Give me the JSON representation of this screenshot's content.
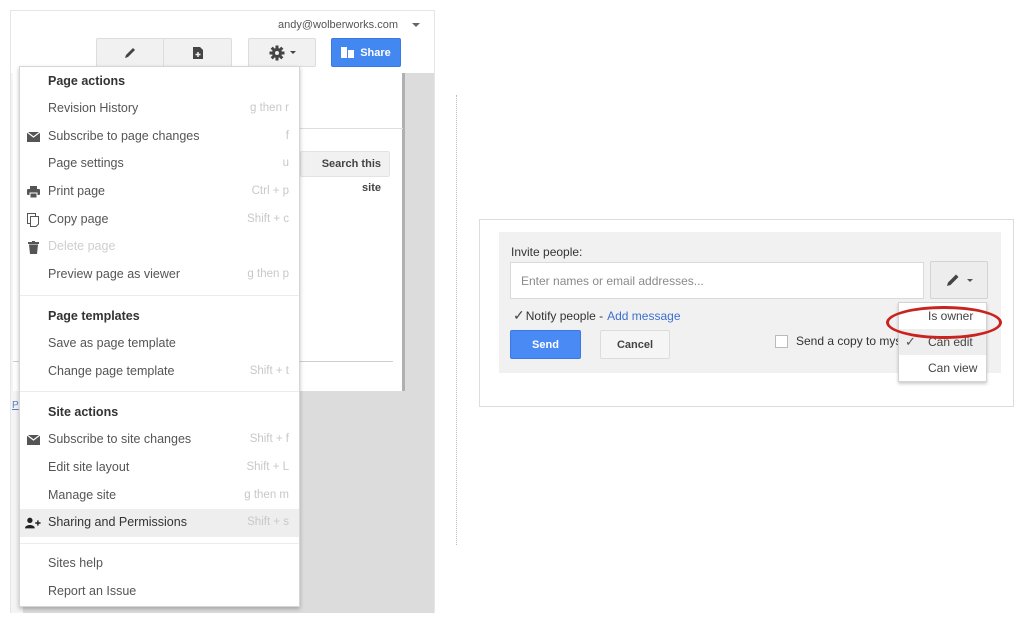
{
  "left_screenshot": {
    "account": {
      "email": "andy@wolberworks.com"
    },
    "toolbar": {
      "edit_icon": "pencil-icon",
      "new_page_icon": "new-page-icon",
      "more_actions_icon": "gear-icon",
      "share_label": "Share",
      "share_icon": "people-icon"
    },
    "search_button_label": "Search this site",
    "side_link_text": "P",
    "menu": {
      "sections": [
        {
          "heading": "Page actions",
          "items": [
            {
              "label": "Revision History",
              "shortcut": "g then r",
              "icon": null,
              "disabled": false
            },
            {
              "label": "Subscribe to page changes",
              "shortcut": "f",
              "icon": "envelope-icon",
              "disabled": false
            },
            {
              "label": "Page settings",
              "shortcut": "u",
              "icon": null,
              "disabled": false
            },
            {
              "label": "Print page",
              "shortcut": "Ctrl + p",
              "icon": "printer-icon",
              "disabled": false
            },
            {
              "label": "Copy page",
              "shortcut": "Shift + c",
              "icon": "copy-icon",
              "disabled": false
            },
            {
              "label": "Delete page",
              "shortcut": "",
              "icon": "trash-icon",
              "disabled": true
            },
            {
              "label": "Preview page as viewer",
              "shortcut": "g then p",
              "icon": null,
              "disabled": false
            }
          ]
        },
        {
          "heading": "Page templates",
          "items": [
            {
              "label": "Save as page template",
              "shortcut": "",
              "icon": null,
              "disabled": false
            },
            {
              "label": "Change page template",
              "shortcut": "Shift + t",
              "icon": null,
              "disabled": false
            }
          ]
        },
        {
          "heading": "Site actions",
          "items": [
            {
              "label": "Subscribe to site changes",
              "shortcut": "Shift + f",
              "icon": "envelope-icon",
              "disabled": false
            },
            {
              "label": "Edit site layout",
              "shortcut": "Shift + L",
              "icon": null,
              "disabled": false
            },
            {
              "label": "Manage site",
              "shortcut": "g then m",
              "icon": null,
              "disabled": false
            },
            {
              "label": "Sharing and Permissions",
              "shortcut": "Shift + s",
              "icon": "add-person-icon",
              "disabled": false,
              "highlighted": true
            }
          ]
        },
        {
          "heading": null,
          "items": [
            {
              "label": "Sites help",
              "shortcut": "",
              "icon": null,
              "disabled": false
            },
            {
              "label": "Report an Issue",
              "shortcut": "",
              "icon": null,
              "disabled": false
            }
          ]
        }
      ]
    }
  },
  "right_screenshot": {
    "invite_label": "Invite people:",
    "invite_input": {
      "value": "",
      "placeholder": "Enter names or email addresses..."
    },
    "permission_button_icon": "pencil-icon",
    "notify": {
      "checked": true,
      "label": "Notify people -",
      "link": "Add message"
    },
    "send_label": "Send",
    "cancel_label": "Cancel",
    "send_copy": {
      "checked": false,
      "label": "Send a copy to myself"
    },
    "permission_menu": {
      "options": [
        {
          "label": "Is owner",
          "selected": false,
          "annotated": true
        },
        {
          "label": "Can edit",
          "selected": true
        },
        {
          "label": "Can view",
          "selected": false
        }
      ]
    },
    "annotation_color": "#c8231f"
  },
  "colors": {
    "primary_blue": "#4387f0",
    "link_blue": "#3d6fce",
    "highlight_gray": "#eeeeee"
  }
}
